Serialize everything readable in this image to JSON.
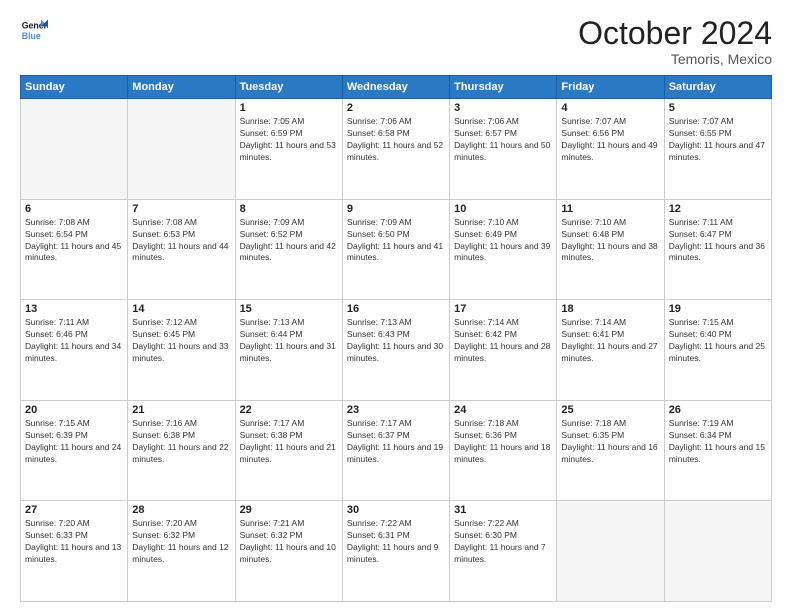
{
  "logo": {
    "text_general": "General",
    "text_blue": "Blue"
  },
  "header": {
    "month": "October 2024",
    "location": "Temoris, Mexico"
  },
  "days": [
    "Sunday",
    "Monday",
    "Tuesday",
    "Wednesday",
    "Thursday",
    "Friday",
    "Saturday"
  ],
  "weeks": [
    [
      {
        "day": "",
        "sunrise": "",
        "sunset": "",
        "daylight": ""
      },
      {
        "day": "",
        "sunrise": "",
        "sunset": "",
        "daylight": ""
      },
      {
        "day": "1",
        "sunrise": "Sunrise: 7:05 AM",
        "sunset": "Sunset: 6:59 PM",
        "daylight": "Daylight: 11 hours and 53 minutes."
      },
      {
        "day": "2",
        "sunrise": "Sunrise: 7:06 AM",
        "sunset": "Sunset: 6:58 PM",
        "daylight": "Daylight: 11 hours and 52 minutes."
      },
      {
        "day": "3",
        "sunrise": "Sunrise: 7:06 AM",
        "sunset": "Sunset: 6:57 PM",
        "daylight": "Daylight: 11 hours and 50 minutes."
      },
      {
        "day": "4",
        "sunrise": "Sunrise: 7:07 AM",
        "sunset": "Sunset: 6:56 PM",
        "daylight": "Daylight: 11 hours and 49 minutes."
      },
      {
        "day": "5",
        "sunrise": "Sunrise: 7:07 AM",
        "sunset": "Sunset: 6:55 PM",
        "daylight": "Daylight: 11 hours and 47 minutes."
      }
    ],
    [
      {
        "day": "6",
        "sunrise": "Sunrise: 7:08 AM",
        "sunset": "Sunset: 6:54 PM",
        "daylight": "Daylight: 11 hours and 45 minutes."
      },
      {
        "day": "7",
        "sunrise": "Sunrise: 7:08 AM",
        "sunset": "Sunset: 6:53 PM",
        "daylight": "Daylight: 11 hours and 44 minutes."
      },
      {
        "day": "8",
        "sunrise": "Sunrise: 7:09 AM",
        "sunset": "Sunset: 6:52 PM",
        "daylight": "Daylight: 11 hours and 42 minutes."
      },
      {
        "day": "9",
        "sunrise": "Sunrise: 7:09 AM",
        "sunset": "Sunset: 6:50 PM",
        "daylight": "Daylight: 11 hours and 41 minutes."
      },
      {
        "day": "10",
        "sunrise": "Sunrise: 7:10 AM",
        "sunset": "Sunset: 6:49 PM",
        "daylight": "Daylight: 11 hours and 39 minutes."
      },
      {
        "day": "11",
        "sunrise": "Sunrise: 7:10 AM",
        "sunset": "Sunset: 6:48 PM",
        "daylight": "Daylight: 11 hours and 38 minutes."
      },
      {
        "day": "12",
        "sunrise": "Sunrise: 7:11 AM",
        "sunset": "Sunset: 6:47 PM",
        "daylight": "Daylight: 11 hours and 36 minutes."
      }
    ],
    [
      {
        "day": "13",
        "sunrise": "Sunrise: 7:11 AM",
        "sunset": "Sunset: 6:46 PM",
        "daylight": "Daylight: 11 hours and 34 minutes."
      },
      {
        "day": "14",
        "sunrise": "Sunrise: 7:12 AM",
        "sunset": "Sunset: 6:45 PM",
        "daylight": "Daylight: 11 hours and 33 minutes."
      },
      {
        "day": "15",
        "sunrise": "Sunrise: 7:13 AM",
        "sunset": "Sunset: 6:44 PM",
        "daylight": "Daylight: 11 hours and 31 minutes."
      },
      {
        "day": "16",
        "sunrise": "Sunrise: 7:13 AM",
        "sunset": "Sunset: 6:43 PM",
        "daylight": "Daylight: 11 hours and 30 minutes."
      },
      {
        "day": "17",
        "sunrise": "Sunrise: 7:14 AM",
        "sunset": "Sunset: 6:42 PM",
        "daylight": "Daylight: 11 hours and 28 minutes."
      },
      {
        "day": "18",
        "sunrise": "Sunrise: 7:14 AM",
        "sunset": "Sunset: 6:41 PM",
        "daylight": "Daylight: 11 hours and 27 minutes."
      },
      {
        "day": "19",
        "sunrise": "Sunrise: 7:15 AM",
        "sunset": "Sunset: 6:40 PM",
        "daylight": "Daylight: 11 hours and 25 minutes."
      }
    ],
    [
      {
        "day": "20",
        "sunrise": "Sunrise: 7:15 AM",
        "sunset": "Sunset: 6:39 PM",
        "daylight": "Daylight: 11 hours and 24 minutes."
      },
      {
        "day": "21",
        "sunrise": "Sunrise: 7:16 AM",
        "sunset": "Sunset: 6:38 PM",
        "daylight": "Daylight: 11 hours and 22 minutes."
      },
      {
        "day": "22",
        "sunrise": "Sunrise: 7:17 AM",
        "sunset": "Sunset: 6:38 PM",
        "daylight": "Daylight: 11 hours and 21 minutes."
      },
      {
        "day": "23",
        "sunrise": "Sunrise: 7:17 AM",
        "sunset": "Sunset: 6:37 PM",
        "daylight": "Daylight: 11 hours and 19 minutes."
      },
      {
        "day": "24",
        "sunrise": "Sunrise: 7:18 AM",
        "sunset": "Sunset: 6:36 PM",
        "daylight": "Daylight: 11 hours and 18 minutes."
      },
      {
        "day": "25",
        "sunrise": "Sunrise: 7:18 AM",
        "sunset": "Sunset: 6:35 PM",
        "daylight": "Daylight: 11 hours and 16 minutes."
      },
      {
        "day": "26",
        "sunrise": "Sunrise: 7:19 AM",
        "sunset": "Sunset: 6:34 PM",
        "daylight": "Daylight: 11 hours and 15 minutes."
      }
    ],
    [
      {
        "day": "27",
        "sunrise": "Sunrise: 7:20 AM",
        "sunset": "Sunset: 6:33 PM",
        "daylight": "Daylight: 11 hours and 13 minutes."
      },
      {
        "day": "28",
        "sunrise": "Sunrise: 7:20 AM",
        "sunset": "Sunset: 6:32 PM",
        "daylight": "Daylight: 11 hours and 12 minutes."
      },
      {
        "day": "29",
        "sunrise": "Sunrise: 7:21 AM",
        "sunset": "Sunset: 6:32 PM",
        "daylight": "Daylight: 11 hours and 10 minutes."
      },
      {
        "day": "30",
        "sunrise": "Sunrise: 7:22 AM",
        "sunset": "Sunset: 6:31 PM",
        "daylight": "Daylight: 11 hours and 9 minutes."
      },
      {
        "day": "31",
        "sunrise": "Sunrise: 7:22 AM",
        "sunset": "Sunset: 6:30 PM",
        "daylight": "Daylight: 11 hours and 7 minutes."
      },
      {
        "day": "",
        "sunrise": "",
        "sunset": "",
        "daylight": ""
      },
      {
        "day": "",
        "sunrise": "",
        "sunset": "",
        "daylight": ""
      }
    ]
  ]
}
